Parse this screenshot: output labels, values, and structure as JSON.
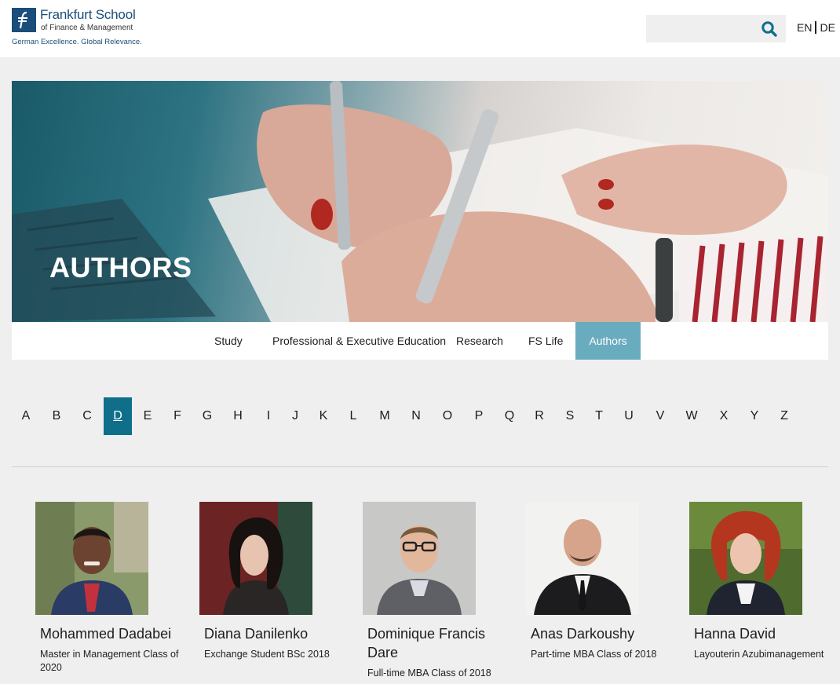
{
  "header": {
    "logo_name": "Frankfurt School",
    "logo_sub": "of Finance & Management",
    "logo_tagline": "German Excellence. Global Relevance.",
    "search_placeholder": "",
    "lang_en": "EN",
    "lang_de": "DE"
  },
  "hero": {
    "title": "AUTHORS"
  },
  "nav": {
    "items": [
      {
        "label": "Study"
      },
      {
        "label": "Professional & Executive Education"
      },
      {
        "label": "Research"
      },
      {
        "label": "FS Life"
      },
      {
        "label": "Authors",
        "active": true
      }
    ]
  },
  "alphabet": {
    "letters": [
      "A",
      "B",
      "C",
      "D",
      "E",
      "F",
      "G",
      "H",
      "I",
      "J",
      "K",
      "L",
      "M",
      "N",
      "O",
      "P",
      "Q",
      "R",
      "S",
      "T",
      "U",
      "V",
      "W",
      "X",
      "Y",
      "Z"
    ],
    "selected": "D"
  },
  "people": [
    {
      "name": "Mohammed Dadabei",
      "desc": "Master in Management Class of 2020"
    },
    {
      "name": "Diana Danilenko",
      "desc": "Exchange Student BSc 2018"
    },
    {
      "name": "Dominique Francis Dare",
      "desc": "Full-time MBA Class of 2018"
    },
    {
      "name": "Anas Darkoushy",
      "desc": "Part-time MBA Class of 2018"
    },
    {
      "name": "Hanna David",
      "desc": "Layouterin Azubimanagement"
    }
  ],
  "colors": {
    "brand": "#1a4d7a",
    "nav_active": "#6aacbf",
    "letter_active": "#0f6f8a",
    "search_icon": "#0f6f8a"
  },
  "icons": {
    "search": "search-icon",
    "logo": "logo-mark-icon"
  }
}
